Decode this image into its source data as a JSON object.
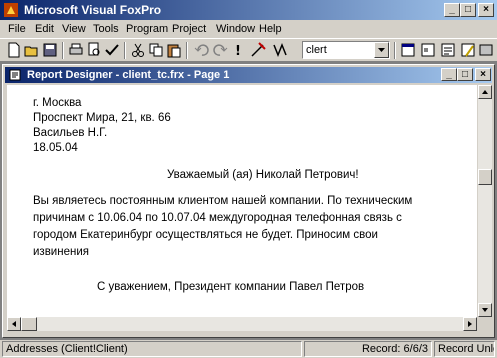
{
  "window": {
    "title": "Microsoft Visual FoxPro",
    "controls": {
      "minimize": "_",
      "maximize": "□",
      "close": "×"
    }
  },
  "menu": [
    "File",
    "Edit",
    "View",
    "Tools",
    "Program",
    "Project",
    "Window",
    "Help"
  ],
  "toolbar": {
    "combo_value": "clert"
  },
  "child_window": {
    "title": "Report Designer - client_tc.frx - Page 1",
    "controls": {
      "minimize": "_",
      "maximize": "□",
      "close": "×"
    }
  },
  "report": {
    "city": "г. Москва",
    "address": "Проспект Мира, 21, кв. 66",
    "name": "Васильев Н.Г.",
    "date": "18.05.04",
    "greeting": "Уважаемый (ая) Николай Петрович!",
    "body": [
      "Вы являетесь постоянным клиентом нашей компании. По техническим",
      "причинам с 10.06.04 по 10.07.04 междугородная телефонная связь с",
      "городом Екатеринбург осуществляться не будет. Приносим свои",
      "извинения"
    ],
    "signature": "С уважением, Президент компании Павел Петров"
  },
  "status": {
    "alias": "Addresses (Client!Client)",
    "record": "Record: 6/6/3",
    "lock": "Record Unloc"
  },
  "colors": {
    "titlebar_start": "#0a246a",
    "titlebar_end": "#a6caf0",
    "chrome": "#d4d0c8",
    "workspace": "#808080"
  }
}
